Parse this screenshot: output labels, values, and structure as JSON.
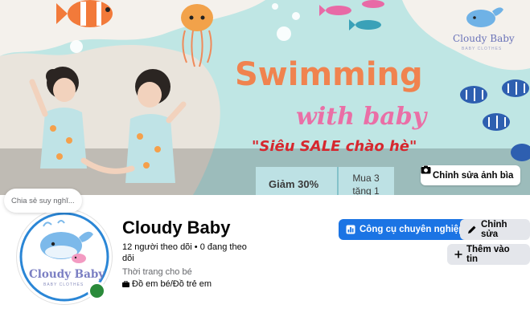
{
  "cover": {
    "headline": "Swimming",
    "subheadline": "with baby",
    "sale_text": "\"Siêu SALE chào hè\"",
    "logo_name": "Cloudy Baby",
    "logo_sub": "BABY CLOTHES",
    "promo_left": "Giảm 30%",
    "promo_right": "Mua 3 tặng 1",
    "edit_cover_label": "Chỉnh sửa ảnh bìa"
  },
  "status_bubble": "Chia sẻ suy nghĩ...",
  "avatar": {
    "brand": "Cloudy Baby",
    "brand_sub": "BABY CLOTHES"
  },
  "profile": {
    "name": "Cloudy Baby",
    "followers": "12 người theo dõi • 0 đang theo dõi",
    "category": "Thời trang cho bé",
    "subcategory": "Đồ em bé/Đồ trẻ em"
  },
  "buttons": {
    "pro_tools": "Công cụ chuyên nghiệp",
    "edit": "Chỉnh sửa",
    "add_story": "Thêm vào tin"
  },
  "colors": {
    "primary": "#1b74e4",
    "secondary_bg": "#e4e6eb",
    "online": "#2a8a3a"
  }
}
